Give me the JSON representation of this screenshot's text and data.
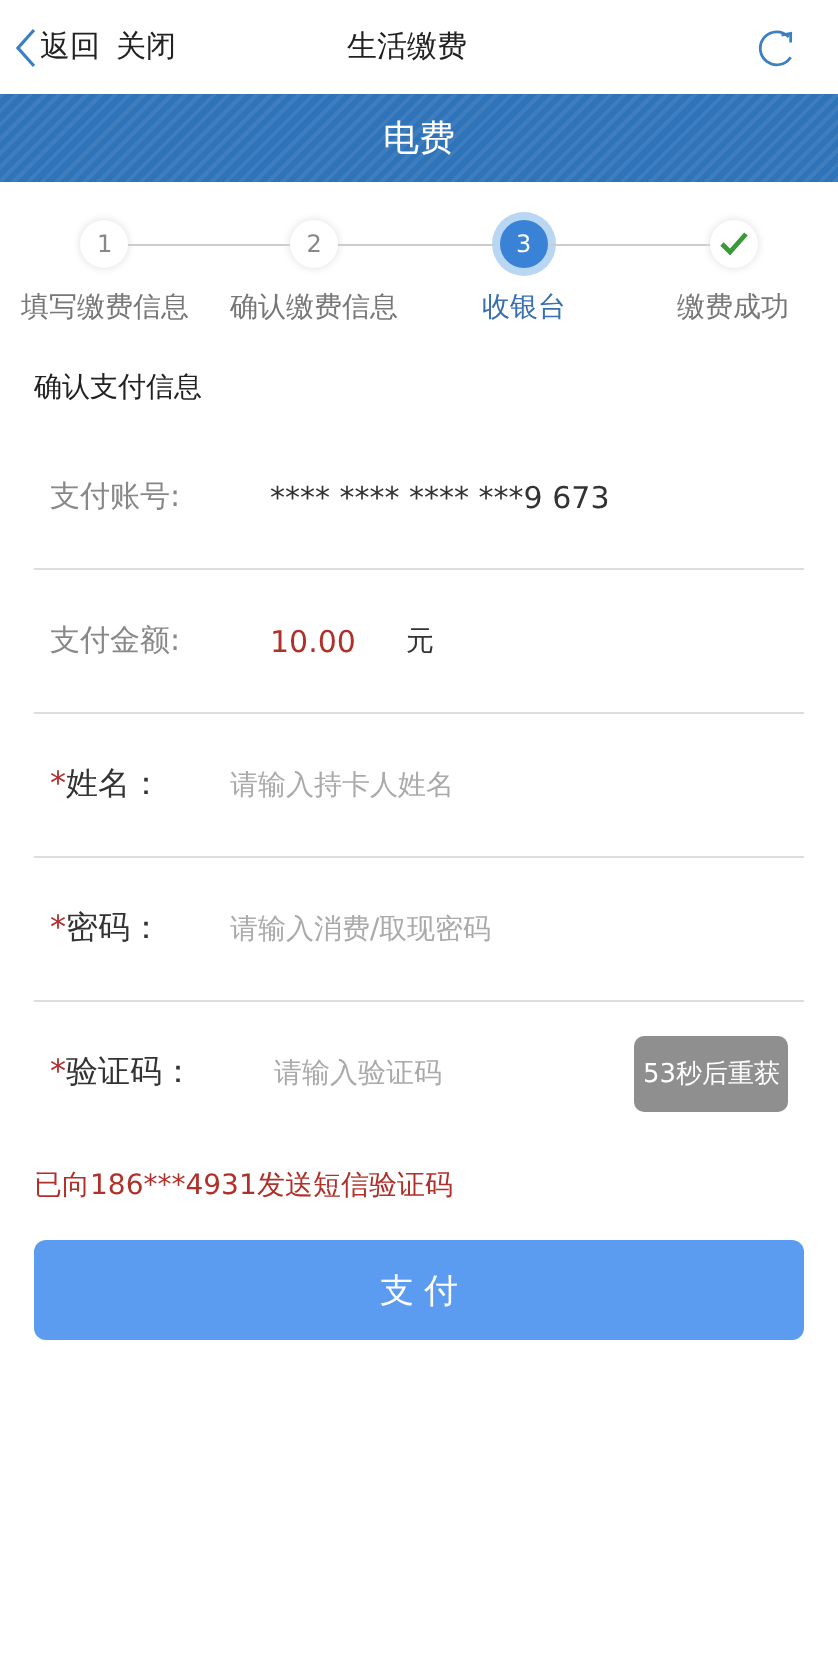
{
  "nav": {
    "back": "返回",
    "close": "关闭",
    "title": "生活缴费"
  },
  "banner": {
    "title": "电费"
  },
  "steps": [
    {
      "kind": "number",
      "text": "1",
      "label": "填写缴费信息",
      "selected": false
    },
    {
      "kind": "number",
      "text": "2",
      "label": "确认缴费信息",
      "selected": false
    },
    {
      "kind": "number",
      "text": "3",
      "label": "收银台",
      "selected": true
    },
    {
      "kind": "check",
      "label": "缴费成功",
      "selected": false
    }
  ],
  "section_title": "确认支付信息",
  "info_rows": [
    {
      "label": "支付账号:",
      "value": "**** **** **** ***9 673"
    },
    {
      "label": "支付金额:",
      "value": "10.00",
      "unit": "元"
    }
  ],
  "fields": [
    {
      "required_mark": "*",
      "label": "姓名：",
      "placeholder": "请输入持卡人姓名"
    },
    {
      "required_mark": "*",
      "label": "密码：",
      "placeholder": "请输入消费/取现密码"
    },
    {
      "required_mark": "*",
      "label": "验证码：",
      "placeholder": "请输入验证码",
      "button": {
        "label": "53秒后重获",
        "disabled": true
      }
    }
  ],
  "sms_notice": "已向186***4931发送短信验证码",
  "pay_button": "支 付"
}
